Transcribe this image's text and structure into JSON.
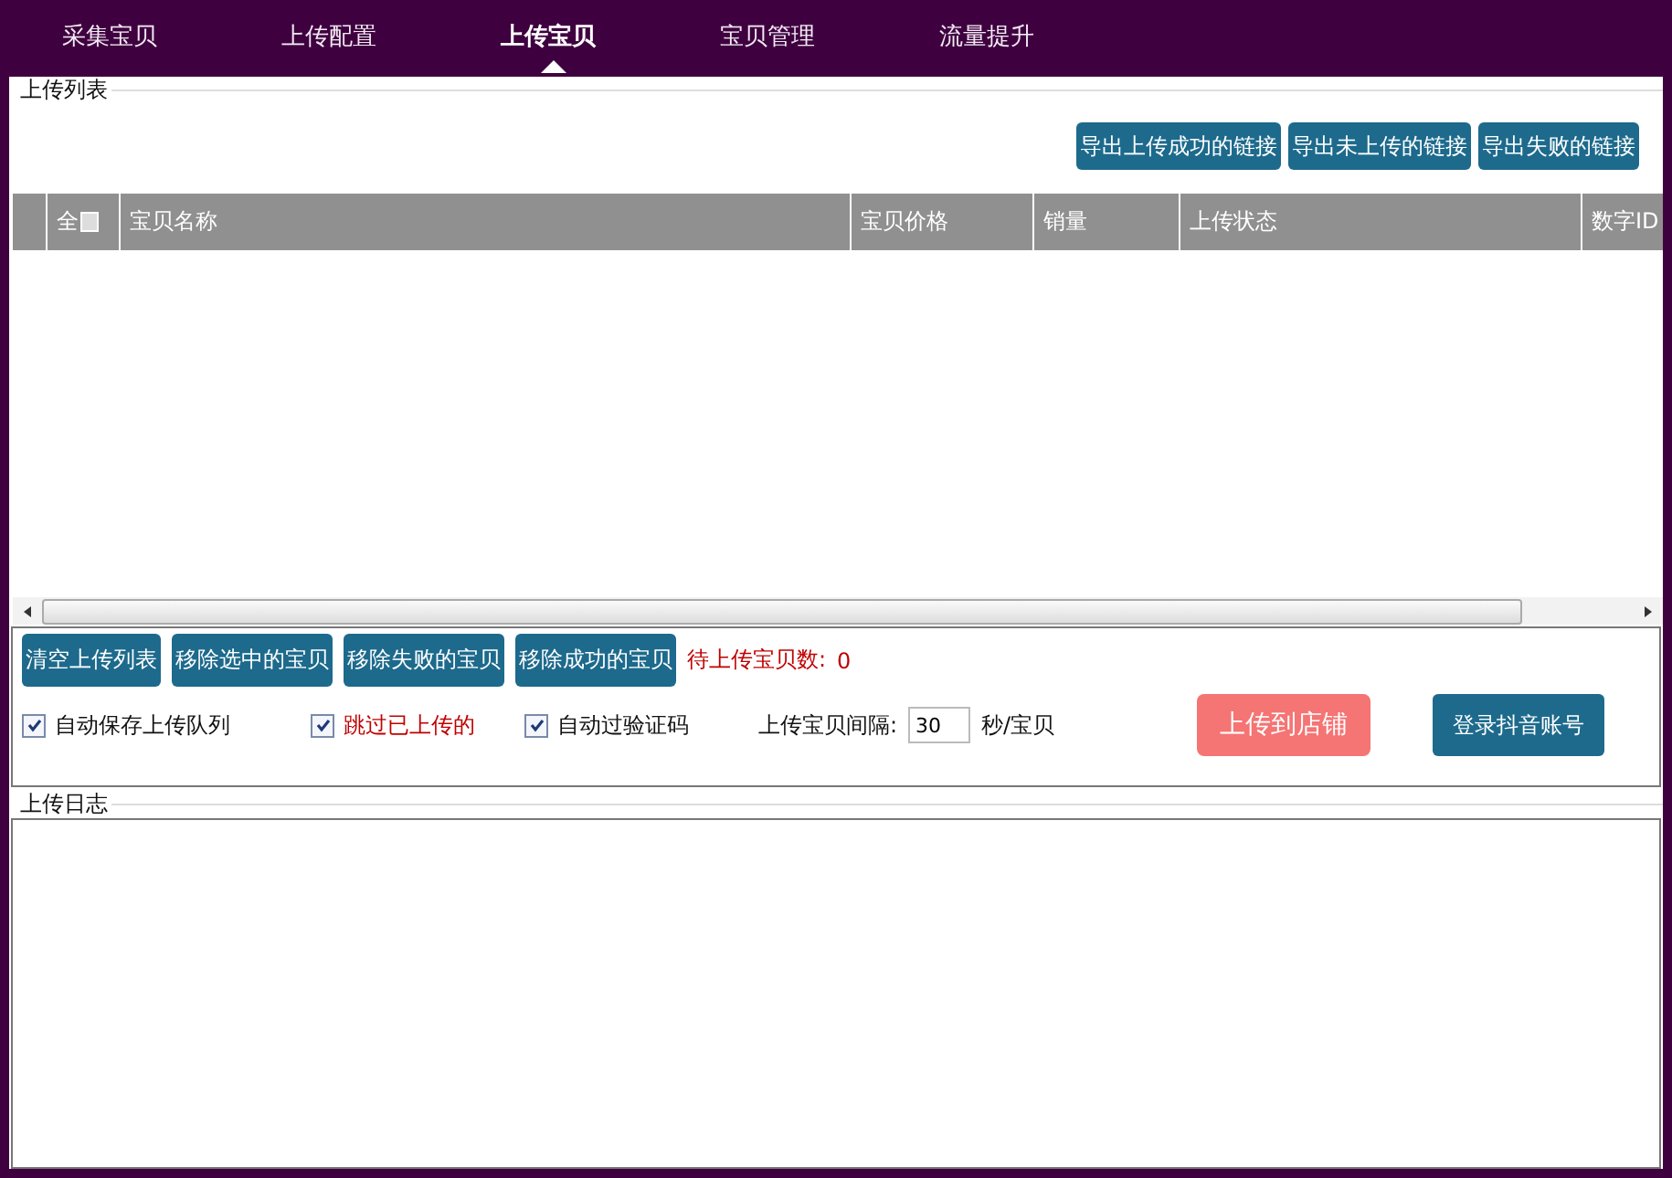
{
  "tabs": [
    {
      "label": "采集宝贝",
      "selected": false
    },
    {
      "label": "上传配置",
      "selected": false
    },
    {
      "label": "上传宝贝",
      "selected": true
    },
    {
      "label": "宝贝管理",
      "selected": false
    },
    {
      "label": "流量提升",
      "selected": false
    }
  ],
  "upload_list": {
    "title": "上传列表",
    "export_buttons": [
      "导出上传成功的链接",
      "导出未上传的链接",
      "导出失败的链接"
    ],
    "table": {
      "select_all": "全",
      "columns": [
        "宝贝名称",
        "宝贝价格",
        "销量",
        "上传状态",
        "数字ID"
      ]
    }
  },
  "controls": {
    "buttons": [
      "清空上传列表",
      "移除选中的宝贝",
      "移除失败的宝贝",
      "移除成功的宝贝"
    ],
    "pending_label": "待上传宝贝数:",
    "pending_count": "0",
    "checkboxes": [
      {
        "label": "自动保存上传队列",
        "checked": true,
        "warning": false
      },
      {
        "label": "跳过已上传的",
        "checked": true,
        "warning": true
      },
      {
        "label": "自动过验证码",
        "checked": true,
        "warning": false
      }
    ],
    "interval_label": "上传宝贝间隔:",
    "interval_value": "30",
    "interval_unit": "秒/宝贝",
    "upload_button": "上传到店铺",
    "login_button": "登录抖音账号"
  },
  "log": {
    "title": "上传日志"
  }
}
